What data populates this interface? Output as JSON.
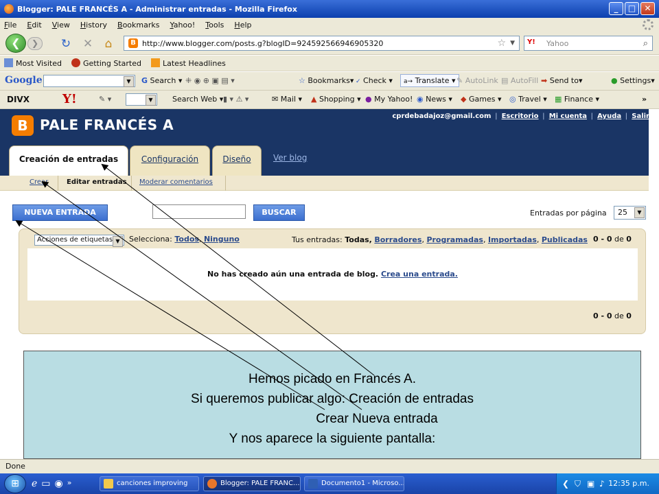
{
  "window": {
    "title": "Blogger: PALE FRANCÉS A - Administrar entradas - Mozilla Firefox"
  },
  "menu": [
    "File",
    "Edit",
    "View",
    "History",
    "Bookmarks",
    "Yahoo!",
    "Tools",
    "Help"
  ],
  "nav": {
    "url": "http://www.blogger.com/posts.g?blogID=924592566946905320",
    "search_placeholder": "Yahoo",
    "search_provider": "Y!"
  },
  "bookmarks": [
    "Most Visited",
    "Getting Started",
    "Latest Headlines"
  ],
  "google_toolbar": {
    "logo": "Google",
    "search": "Search",
    "bookmarks": "Bookmarks",
    "check": "Check",
    "translate": "Translate",
    "autolink": "AutoLink",
    "autofill": "AutoFill",
    "sendto": "Send to",
    "settings": "Settings"
  },
  "yahoo_toolbar": {
    "divx": "DIVX",
    "yahoo": "Y!",
    "searchweb": "Search Web",
    "mail": "Mail",
    "shopping": "Shopping",
    "myyahoo": "My Yahoo!",
    "news": "News",
    "games": "Games",
    "travel": "Travel",
    "finance": "Finance"
  },
  "blog": {
    "icon_letter": "B",
    "title": "PALE FRANCÉS A",
    "email": "cprdebadajoz@gmail.com",
    "links": [
      "Escritorio",
      "Mi cuenta",
      "Ayuda",
      "Salir"
    ],
    "tabs": [
      "Creación de entradas",
      "Configuración",
      "Diseño"
    ],
    "view_blog": "Ver blog",
    "subnav": {
      "crear": "Crear",
      "editar": "Editar entradas",
      "moderar": "Moderar comentarios"
    },
    "buttons": {
      "nueva": "NUEVA ENTRADA",
      "buscar": "BUSCAR"
    },
    "per_page_label": "Entradas por página",
    "per_page_value": "25",
    "actions_select": "Acciones de etiquetas...",
    "select_label": "Selecciona:",
    "select_all": "Todos",
    "select_none": "Ninguno",
    "your_posts_label": "Tus entradas:",
    "filter_all": "Todas,",
    "filters": [
      "Borradores",
      "Programadas",
      "Importadas",
      "Publicadas"
    ],
    "count": "0 - 0",
    "count_of": "de",
    "count_total": "0",
    "empty_msg": "No has creado aún una entrada de blog.",
    "create_link": "Crea una entrada."
  },
  "note": {
    "lines": [
      "Hemos picado en Francés A.",
      "Si queremos publicar algo: Creación de entradas",
      "Crear Nueva entrada",
      "Y nos aparece la siguiente pantalla:"
    ]
  },
  "status": "Done",
  "taskbar": {
    "items": [
      "canciones improving",
      "Blogger: PALE FRANC...",
      "Documento1 - Microso..."
    ],
    "clock": "12:35 p.m."
  }
}
